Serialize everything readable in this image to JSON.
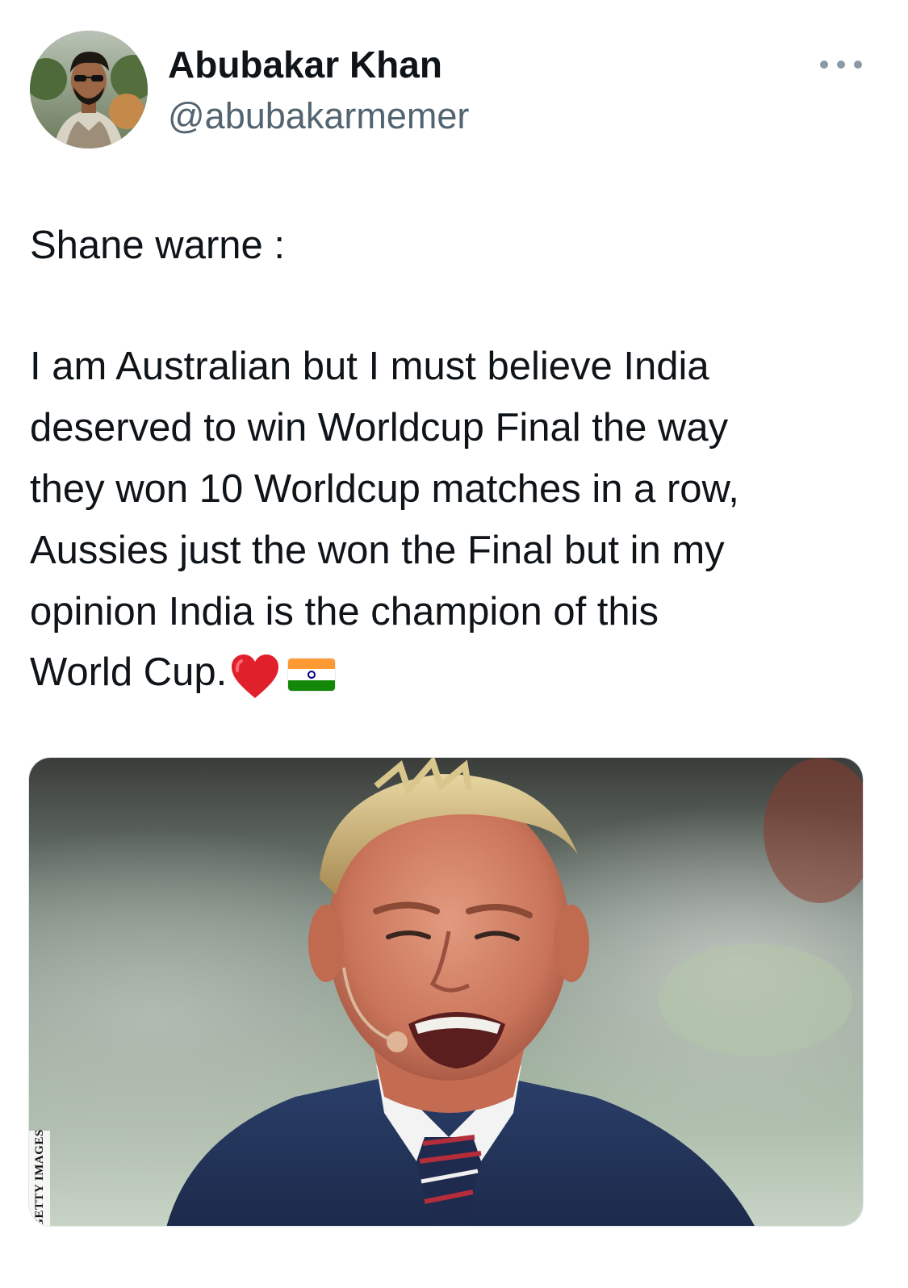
{
  "author": {
    "display_name": "Abubakar Khan",
    "handle": "@abubakarmemer"
  },
  "menu": {
    "icon": "more-horizontal-icon"
  },
  "tweet": {
    "lines": [
      "Shane warne :",
      "I am Australian but I must believe India",
      "deserved to win Worldcup Final the way",
      "they won 10 Worldcup matches in a row,",
      "Aussies just the won the Final but in my",
      "opinion India is the champion of this",
      "World Cup."
    ],
    "emojis": [
      "heart-icon",
      "india-flag-icon"
    ]
  },
  "media": {
    "watermark": "GETTY IMAGES"
  },
  "colors": {
    "text": "#0f1419",
    "secondary": "#536471",
    "heart": "#e0202b"
  }
}
